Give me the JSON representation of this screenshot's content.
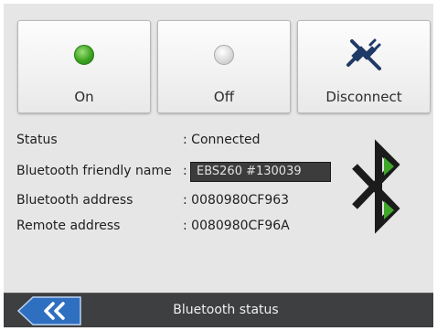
{
  "buttons": {
    "on_label": "On",
    "off_label": "Off",
    "disconnect_label": "Disconnect"
  },
  "info": {
    "status_label": "Status",
    "status_value": ": Connected",
    "friendly_name_label": "Bluetooth friendly name",
    "friendly_name_sep": ":",
    "friendly_name_value": "EBS260 #130039",
    "address_label": "Bluetooth address",
    "address_value": ": 0080980CF963",
    "remote_label": "Remote address",
    "remote_value": ": 0080980CF96A"
  },
  "bottombar": {
    "title": "Bluetooth status",
    "back_icon": "double-chevron-left-icon"
  },
  "colors": {
    "led_on": "#3da420",
    "bluetooth_arrow": "#3fa62a",
    "disconnect_icon": "#1f3a66",
    "bar_bg": "#3d3f41",
    "back_button": "#2f6fc0"
  },
  "icons": [
    "led-on-icon",
    "led-off-icon",
    "disconnect-plug-icon",
    "bluetooth-icon",
    "double-chevron-left-icon"
  ]
}
